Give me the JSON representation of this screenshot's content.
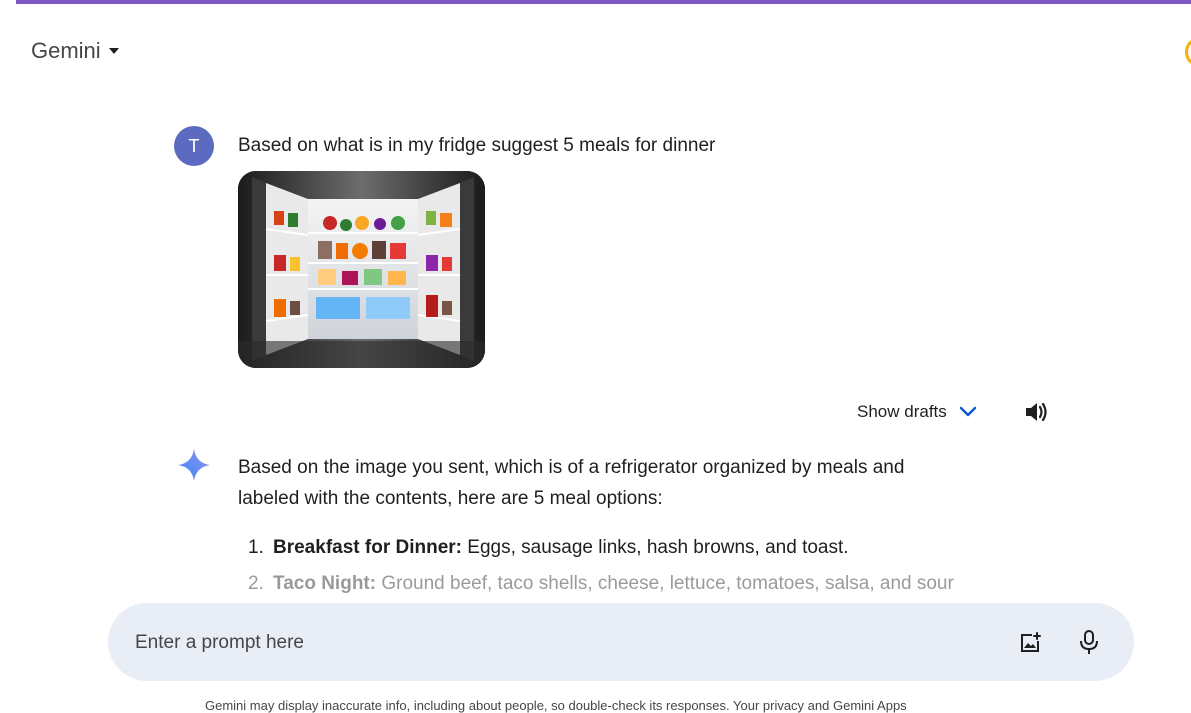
{
  "header": {
    "brand": "Gemini"
  },
  "user_message": {
    "avatar_letter": "T",
    "text": "Based on what is in my fridge suggest 5 meals for dinner"
  },
  "response_controls": {
    "show_drafts_label": "Show drafts"
  },
  "response": {
    "intro_line1": "Based on the image you sent, which is of a refrigerator organized by meals and",
    "intro_line2": "labeled with the contents, here are 5 meal options:",
    "items": [
      {
        "num": "1.",
        "title": "Breakfast for Dinner:",
        "text": " Eggs, sausage links, hash browns, and toast."
      },
      {
        "num": "2.",
        "title": "Taco Night:",
        "text": " Ground beef, taco shells, cheese, lettuce, tomatoes, salsa, and sour"
      }
    ]
  },
  "prompt": {
    "placeholder": "Enter a prompt here"
  },
  "footer": {
    "disclaimer": "Gemini may display inaccurate info, including about people, so double-check its responses. Your privacy and Gemini Apps"
  },
  "colors": {
    "accent_line": "#7e57c2",
    "user_avatar": "#5c6bc0",
    "link_blue": "#0b57d0",
    "prompt_bg": "#e9eef6"
  }
}
